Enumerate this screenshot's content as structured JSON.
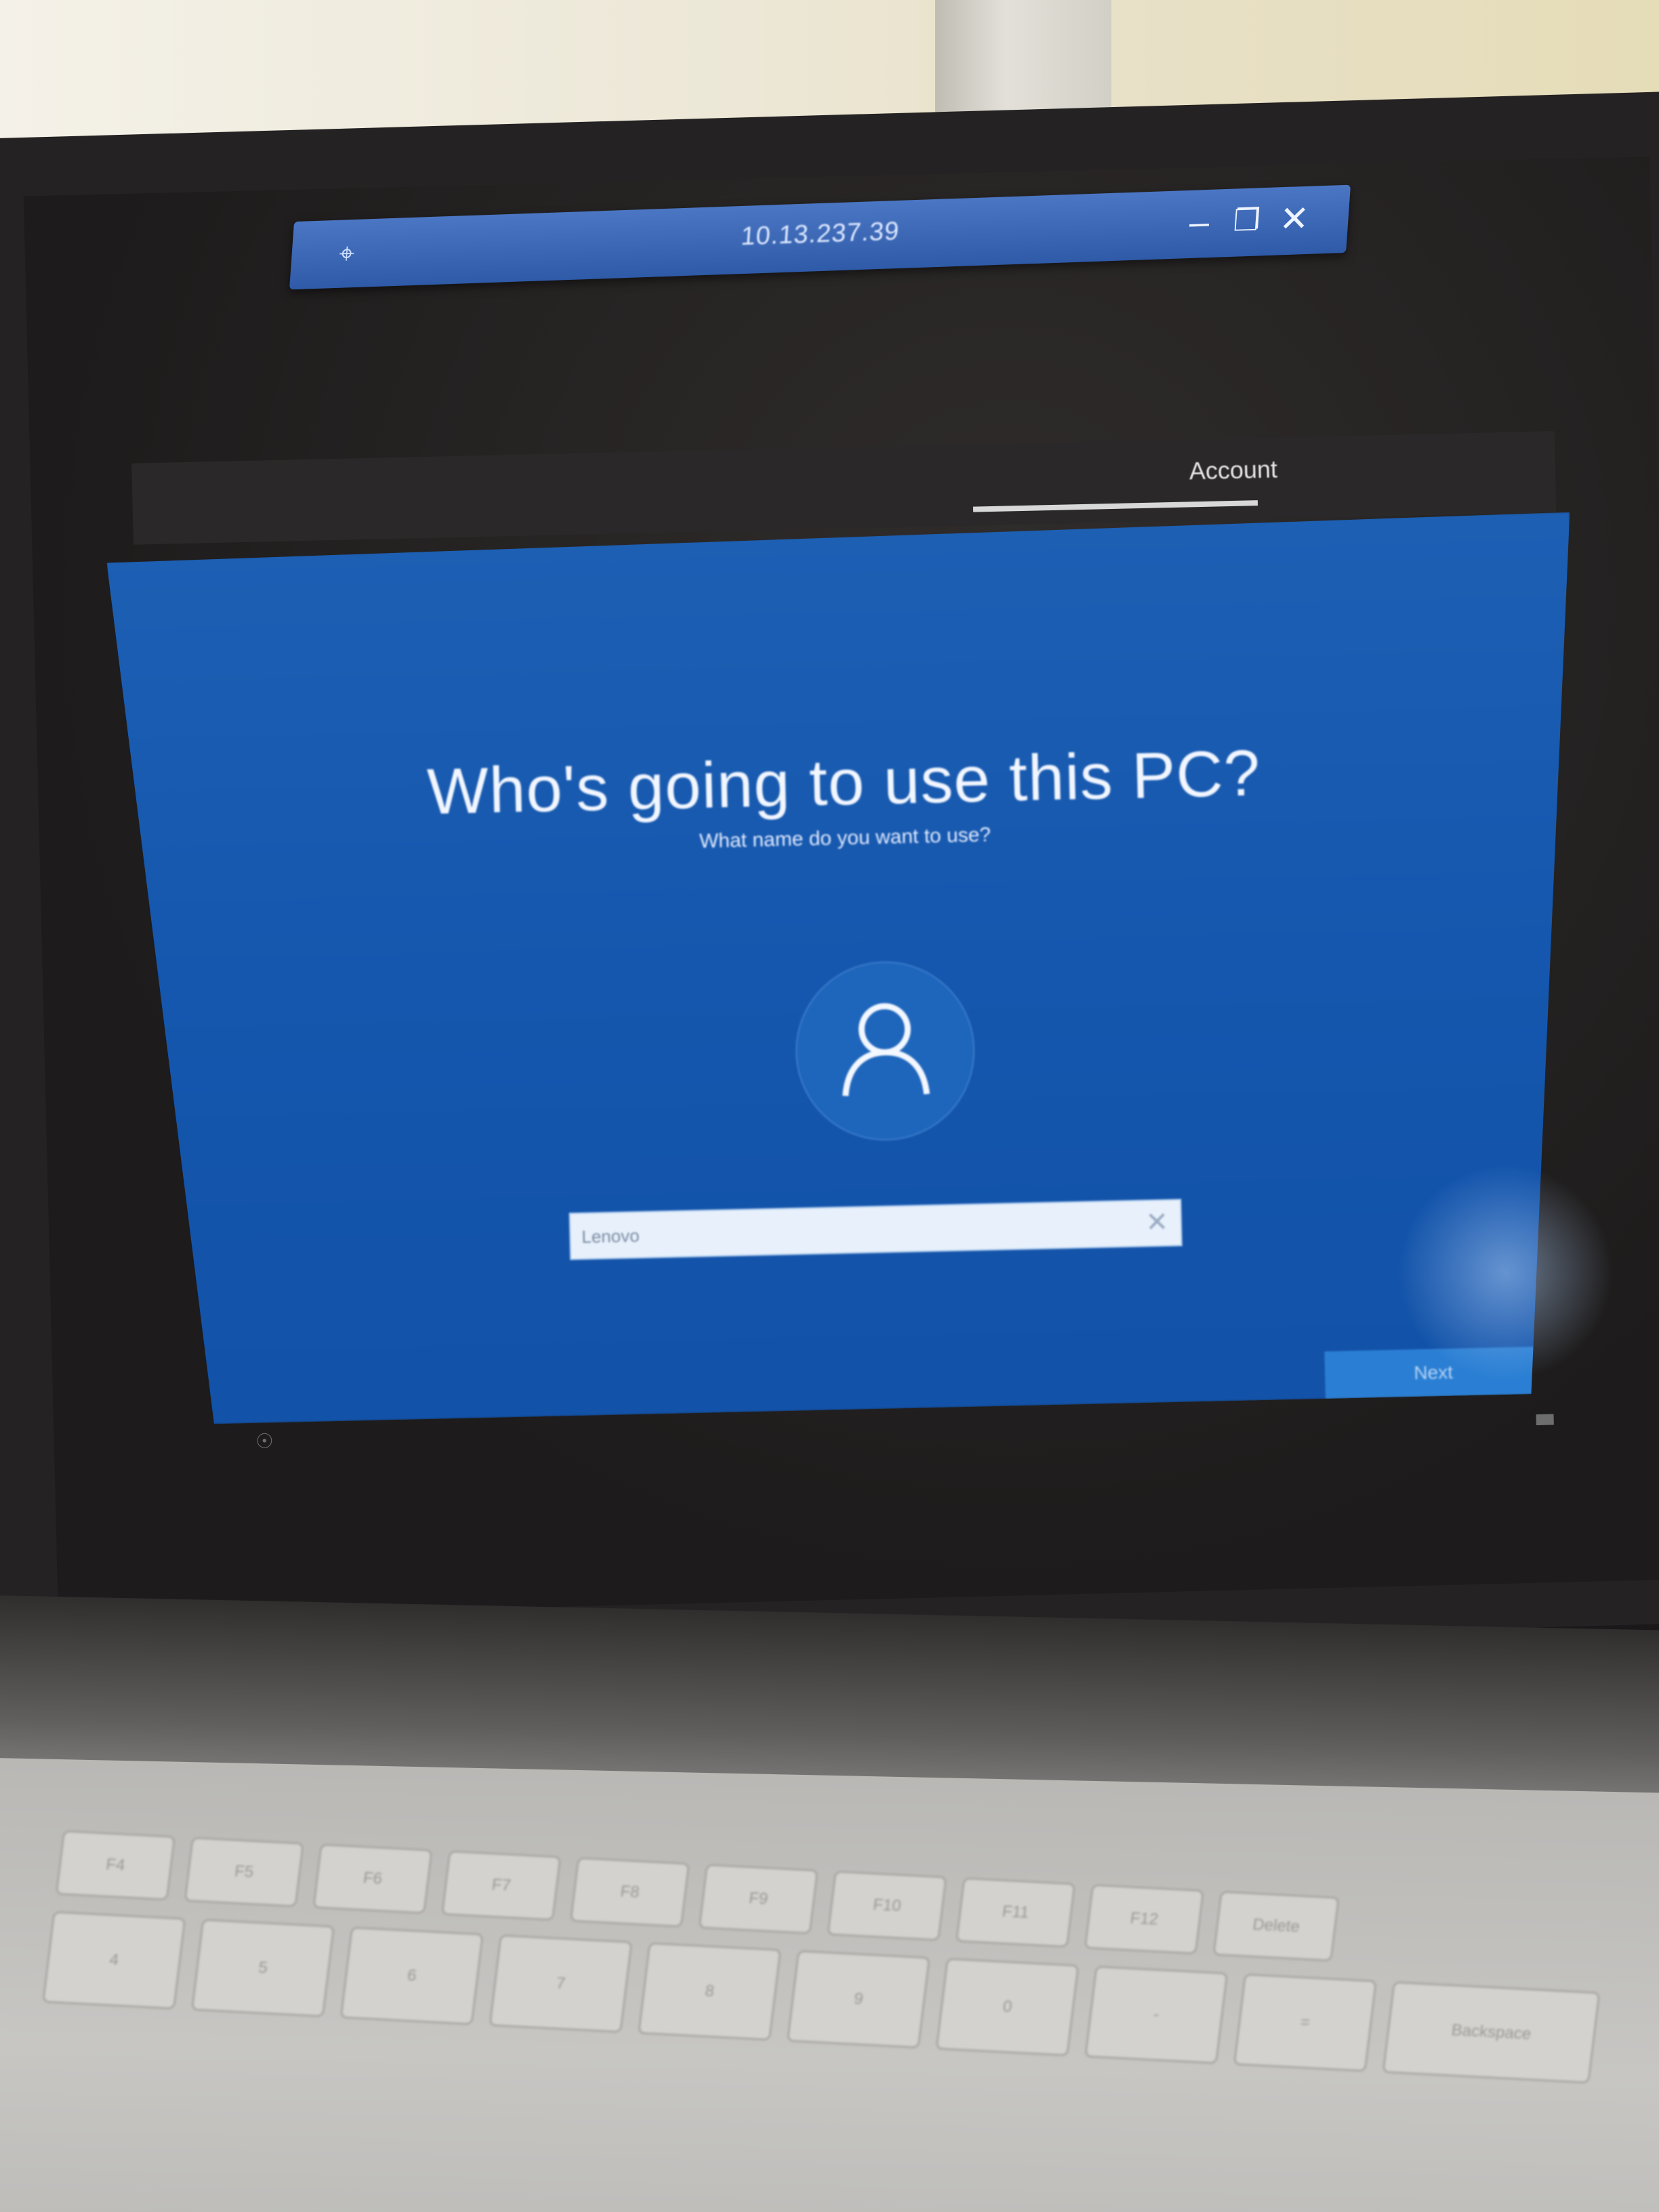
{
  "remote_session": {
    "title": "10.13.237.39",
    "pin_icon": "pin-icon",
    "minimize_label": "–",
    "restore_label": "❐",
    "close_label": "✕"
  },
  "oobe": {
    "tab_label": "Account",
    "heading": "Who's going to use this PC?",
    "subheading": "What name do you want to use?",
    "avatar_icon": "user-icon",
    "name_field": {
      "value": "Lenovo",
      "clear_label": "✕"
    },
    "next_button": "Next"
  },
  "keyboard": {
    "fn_row": [
      "F4",
      "F5",
      "F6",
      "F7",
      "F8",
      "F9",
      "F10",
      "F11",
      "F12",
      "Delete"
    ],
    "number_row": [
      "4",
      "5",
      "6",
      "7",
      "8",
      "9",
      "0",
      "-",
      "=",
      "Backspace"
    ]
  },
  "colors": {
    "oobe_blue": "#1557ae",
    "next_button": "#2a7fd4",
    "rdp_bar": "#2e5aa8"
  }
}
